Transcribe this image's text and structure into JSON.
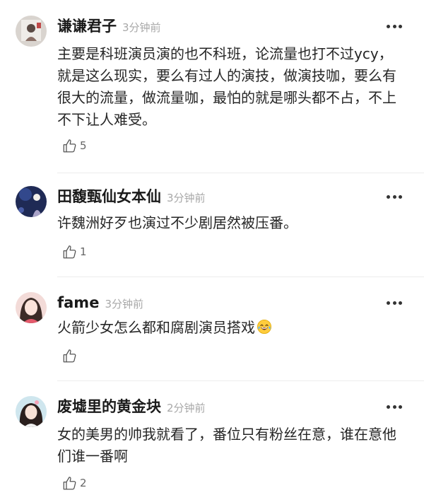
{
  "comments": [
    {
      "username": "谦谦君子",
      "time": "3分钟前",
      "text": "主要是科班演员演的也不科班，论流量也打不过ycy，就是这么现实，要么有过人的演技，做演技咖，要么有很大的流量，做流量咖，最怕的就是哪头都不占，不上不下让人难受。",
      "likes": "5",
      "avatar": "avatar-1"
    },
    {
      "username": "田馥甄仙女本仙",
      "time": "3分钟前",
      "text": "许魏洲好歹也演过不少剧居然被压番。",
      "likes": "1",
      "avatar": "avatar-2"
    },
    {
      "username": "fame",
      "time": "3分钟前",
      "text": "火箭少女怎么都和腐剧演员搭戏",
      "emoji": "tears-of-joy-emoji",
      "likes": "",
      "avatar": "avatar-3"
    },
    {
      "username": "废墟里的黄金块",
      "time": "2分钟前",
      "text": "女的美男的帅我就看了，番位只有粉丝在意，谁在意他们谁一番啊",
      "likes": "2",
      "avatar": "avatar-4"
    }
  ],
  "icons": {
    "like": "thumbs-up-icon",
    "more": "more-icon"
  }
}
